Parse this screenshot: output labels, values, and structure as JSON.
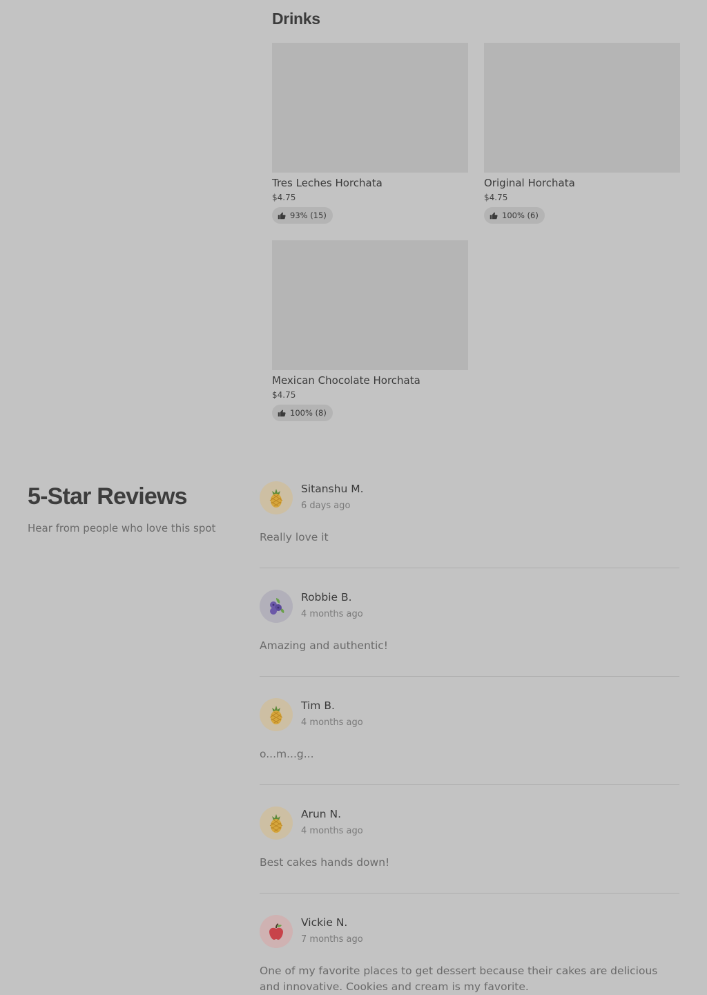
{
  "drinks": {
    "title": "Drinks",
    "items": [
      {
        "name": "Tres Leches Horchata",
        "price": "$4.75",
        "rating": "93% (15)"
      },
      {
        "name": "Original Horchata",
        "price": "$4.75",
        "rating": "100% (6)"
      },
      {
        "name": "Mexican Chocolate Horchata",
        "price": "$4.75",
        "rating": "100% (8)"
      }
    ]
  },
  "reviews": {
    "title": "5-Star Reviews",
    "subtitle": "Hear from people who love this spot",
    "list": [
      {
        "name": "Sitanshu M.",
        "time": "6 days ago",
        "text": "Really love it",
        "avatar": "pineapple-icon"
      },
      {
        "name": "Robbie B.",
        "time": "4 months ago",
        "text": "Amazing and authentic!",
        "avatar": "blueberry-icon"
      },
      {
        "name": "Tim B.",
        "time": "4 months ago",
        "text": "o...m...g...",
        "avatar": "pineapple-icon"
      },
      {
        "name": "Arun N.",
        "time": "4 months ago",
        "text": "Best cakes hands down!",
        "avatar": "pineapple-icon"
      },
      {
        "name": "Vickie N.",
        "time": "7 months ago",
        "text": "One of my favorite places to get dessert because their cakes are delicious and innovative. Cookies and cream is my favorite.",
        "avatar": "apple-icon"
      }
    ]
  },
  "colors": {
    "overlay_background": "#c3c3c3",
    "image_placeholder": "#b5b5b5",
    "badge_background": "#b4b4b4",
    "avatar_pineapple_bg": "#cdbfa3",
    "avatar_blueberry_bg": "#b2b0ba",
    "avatar_apple_bg": "#cfb2b2"
  }
}
